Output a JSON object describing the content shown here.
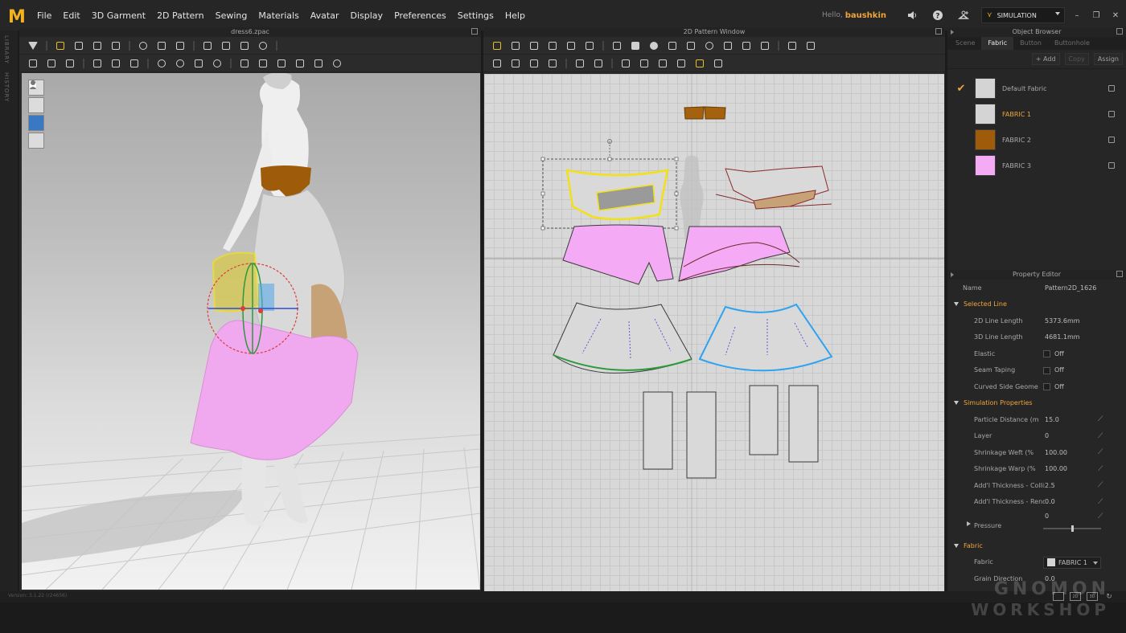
{
  "app": {
    "logo": "M",
    "menu": [
      "File",
      "Edit",
      "3D Garment",
      "2D Pattern",
      "Sewing",
      "Materials",
      "Avatar",
      "Display",
      "Preferences",
      "Settings",
      "Help"
    ],
    "hello": "Hello,",
    "username": "baushkin",
    "mode": "SIMULATION",
    "icons": [
      "speaker-icon",
      "help-icon",
      "hanger-icon"
    ]
  },
  "left_strip": {
    "library": "LIBRARY",
    "history": "HISTORY"
  },
  "window3d": {
    "title": "dress6.zpac"
  },
  "window2d": {
    "title": "2D Pattern Window"
  },
  "object_browser": {
    "title": "Object Browser",
    "tabs": [
      "Scene",
      "Fabric",
      "Button",
      "Buttonhole"
    ],
    "active_tab": "Fabric",
    "actions": {
      "add": "+ Add",
      "copy": "Copy",
      "assign": "Assign"
    },
    "fabrics": [
      {
        "name": "Default Fabric",
        "color": "#d4d4d4",
        "checked": true,
        "selected": false
      },
      {
        "name": "FABRIC 1",
        "color": "#d4d4d4",
        "checked": false,
        "selected": true
      },
      {
        "name": "FABRIC 2",
        "color": "#9e5c0a",
        "checked": false,
        "selected": false
      },
      {
        "name": "FABRIC 3",
        "color": "#f4aaf4",
        "checked": false,
        "selected": false
      }
    ]
  },
  "property_editor": {
    "title": "Property Editor",
    "name_label": "Name",
    "name_value": "Pattern2D_1626",
    "selected_line": {
      "header": "Selected Line",
      "rows": [
        {
          "label": "2D Line Length",
          "value": "5373.6mm"
        },
        {
          "label": "3D Line Length",
          "value": "4681.1mm"
        },
        {
          "label": "Elastic",
          "value": "Off",
          "check": true
        },
        {
          "label": "Seam Taping",
          "value": "Off",
          "check": true
        },
        {
          "label": "Curved Side Geome",
          "value": "Off",
          "check": true
        }
      ]
    },
    "simulation": {
      "header": "Simulation Properties",
      "rows": [
        {
          "label": "Particle Distance (m",
          "value": "15.0"
        },
        {
          "label": "Layer",
          "value": "0"
        },
        {
          "label": "Shrinkage Weft (%",
          "value": "100.00"
        },
        {
          "label": "Shrinkage Warp (%",
          "value": "100.00"
        },
        {
          "label": "Add'l Thickness - Collisic",
          "value": "2.5"
        },
        {
          "label": "Add'l Thickness - Render",
          "value": "0.0"
        }
      ],
      "pressure_label": "Pressure",
      "pressure_value": "0",
      "pressure_slider": 0.5
    },
    "fabric": {
      "header": "Fabric",
      "fabric_label": "Fabric",
      "fabric_value": "FABRIC 1",
      "grain_label": "Grain Direction",
      "grain_value": "0.0"
    }
  },
  "status": {
    "version": "Version: 3.1.22  (r24656)",
    "icons": [
      "layout-icon",
      "2d-icon",
      "3d-icon",
      "refresh-icon"
    ],
    "icon_labels": [
      "",
      "2D",
      "3D",
      "↻"
    ]
  },
  "watermark": {
    "line1": "GNOMON",
    "line2": "WORKSHOP"
  },
  "colors": {
    "accent": "#f0a53a",
    "pink": "#f4aaf4",
    "brown": "#9e5c0a",
    "selection_yellow": "#f2e018",
    "selection_blue": "#2fa3f0",
    "selection_green": "#2a9a3a"
  }
}
